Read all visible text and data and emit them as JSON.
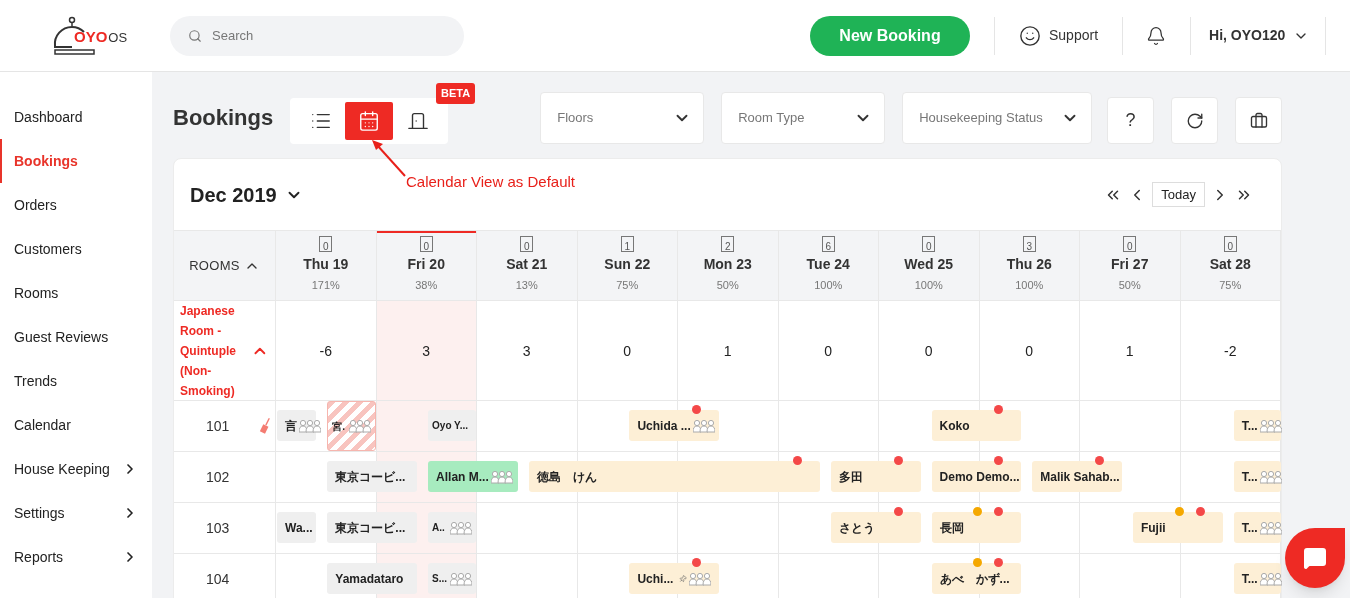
{
  "header": {
    "logo": {
      "brand": "OYO",
      "suffix": "OS"
    },
    "search": {
      "placeholder": "Search"
    },
    "new_booking": "New Booking",
    "support": "Support",
    "user": "Hi, OYO120"
  },
  "sidebar": {
    "items": [
      {
        "label": "Dashboard",
        "selected": false,
        "has_submenu": false
      },
      {
        "label": "Bookings",
        "selected": true,
        "has_submenu": false
      },
      {
        "label": "Orders",
        "selected": false,
        "has_submenu": false
      },
      {
        "label": "Customers",
        "selected": false,
        "has_submenu": false
      },
      {
        "label": "Rooms",
        "selected": false,
        "has_submenu": false
      },
      {
        "label": "Guest Reviews",
        "selected": false,
        "has_submenu": false
      },
      {
        "label": "Trends",
        "selected": false,
        "has_submenu": false
      },
      {
        "label": "Calendar",
        "selected": false,
        "has_submenu": false
      },
      {
        "label": "House Keeping",
        "selected": false,
        "has_submenu": true
      },
      {
        "label": "Settings",
        "selected": false,
        "has_submenu": true
      },
      {
        "label": "Reports",
        "selected": false,
        "has_submenu": true
      }
    ]
  },
  "toolbar": {
    "title": "Bookings",
    "badge": "BETA",
    "views": [
      {
        "kind": "list",
        "selected": false
      },
      {
        "kind": "calendar",
        "selected": true
      },
      {
        "kind": "door",
        "selected": false
      }
    ],
    "filters": [
      {
        "placeholder": "Floors"
      },
      {
        "placeholder": "Room Type"
      },
      {
        "placeholder": "Housekeeping Status"
      }
    ],
    "help": "?"
  },
  "annotation": {
    "text": "Calendar View as Default"
  },
  "calendar": {
    "month": "Dec 2019",
    "today": "Today",
    "rooms_heading": "ROOMS",
    "days": [
      {
        "label": "Thu 19",
        "count": "0",
        "occupancy": "171%",
        "selected": false
      },
      {
        "label": "Fri 20",
        "count": "0",
        "occupancy": "38%",
        "selected": true
      },
      {
        "label": "Sat 21",
        "count": "0",
        "occupancy": "13%",
        "selected": false
      },
      {
        "label": "Sun 22",
        "count": "1",
        "occupancy": "75%",
        "selected": false
      },
      {
        "label": "Mon 23",
        "count": "2",
        "occupancy": "50%",
        "selected": false
      },
      {
        "label": "Tue 24",
        "count": "6",
        "occupancy": "100%",
        "selected": false
      },
      {
        "label": "Wed 25",
        "count": "0",
        "occupancy": "100%",
        "selected": false
      },
      {
        "label": "Thu 26",
        "count": "3",
        "occupancy": "100%",
        "selected": false
      },
      {
        "label": "Fri 27",
        "count": "0",
        "occupancy": "50%",
        "selected": false
      },
      {
        "label": "Sat 28",
        "count": "0",
        "occupancy": "75%",
        "selected": false
      }
    ],
    "category": {
      "name": "Japanese Room - Quintuple (Non-Smoking)",
      "expanded": true,
      "availability": [
        "-6",
        "3",
        "3",
        "0",
        "1",
        "0",
        "0",
        "0",
        "1",
        "-2"
      ]
    },
    "rooms": [
      {
        "number": "101",
        "dirty": true,
        "carried_over": [
          {
            "name": "言",
            "kind": "past",
            "group": true,
            "pinned": false
          }
        ],
        "cells": [
          {
            "bookings": [
              {
                "name": "宮.",
                "kind": "blocked",
                "group": true,
                "pinned": false
              }
            ]
          },
          {
            "bookings": [
              {
                "name": "Oyo Y...",
                "kind": "pastpartial",
                "group": false,
                "pinned": false
              }
            ]
          },
          {},
          {
            "bookings": [
              {
                "name": "Uchida ...",
                "kind": "upcoming",
                "group": true,
                "pinned": false,
                "dots": [
                  {
                    "color": "#f44848"
                  }
                ]
              }
            ]
          },
          {},
          {},
          {
            "bookings": [
              {
                "name": "Koko",
                "kind": "upcoming",
                "group": false,
                "pinned": false,
                "dots": [
                  {
                    "color": "#f44848"
                  }
                ]
              }
            ]
          },
          {},
          {},
          {
            "bookings": [
              {
                "name": "T...",
                "kind": "upcoming",
                "group": true,
                "pinned": false
              }
            ]
          }
        ]
      },
      {
        "number": "102",
        "dirty": false,
        "cells": [
          {
            "bookings": [
              {
                "name": "東京コービ...",
                "kind": "past",
                "group": false,
                "pinned": false
              }
            ]
          },
          {
            "bookings": [
              {
                "name": "Allan M...",
                "kind": "inhouse",
                "group": true,
                "pinned": false
              }
            ]
          },
          {
            "bookings": [
              {
                "name": "徳島　けん",
                "kind": "upcomingtriple",
                "group": false,
                "pinned": false,
                "dots": [
                  {
                    "color": "#f44848"
                  }
                ]
              }
            ]
          },
          {},
          {},
          {
            "bookings": [
              {
                "name": "多田",
                "kind": "upcoming",
                "group": false,
                "pinned": false,
                "dots": [
                  {
                    "color": "#f44848"
                  }
                ]
              }
            ]
          },
          {
            "bookings": [
              {
                "name": "Demo Demo...",
                "kind": "upcoming",
                "group": false,
                "pinned": false,
                "dots": [
                  {
                    "color": "#f44848"
                  }
                ]
              }
            ]
          },
          {
            "bookings": [
              {
                "name": "Malik Sahab...",
                "kind": "upcoming",
                "group": false,
                "pinned": false,
                "dots": [
                  {
                    "color": "#f44848"
                  }
                ]
              }
            ]
          },
          {},
          {
            "bookings": [
              {
                "name": "T...",
                "kind": "upcoming",
                "group": true,
                "pinned": false
              }
            ]
          }
        ]
      },
      {
        "number": "103",
        "dirty": false,
        "carried_over": [
          {
            "name": "Wa...",
            "kind": "past",
            "group": false,
            "pinned": false
          }
        ],
        "cells": [
          {
            "bookings": [
              {
                "name": "東京コービ...",
                "kind": "past",
                "group": false,
                "pinned": false
              }
            ]
          },
          {
            "bookings": [
              {
                "name": "A..",
                "kind": "pastpartial",
                "group": true,
                "pinned": false
              }
            ]
          },
          {},
          {},
          {},
          {
            "bookings": [
              {
                "name": "さとう",
                "kind": "upcoming",
                "group": false,
                "pinned": false,
                "dots": [
                  {
                    "color": "#f44848"
                  }
                ]
              }
            ]
          },
          {
            "bookings": [
              {
                "name": "長岡",
                "kind": "upcoming",
                "group": false,
                "pinned": false,
                "dots": [
                  {
                    "color": "#f5a800"
                  },
                  {
                    "color": "#f44848"
                  }
                ]
              }
            ]
          },
          {},
          {
            "bookings": [
              {
                "name": "Fujii",
                "kind": "upcoming",
                "group": false,
                "pinned": false,
                "dots": [
                  {
                    "color": "#f5a800"
                  },
                  {
                    "color": "#f44848"
                  }
                ]
              }
            ]
          },
          {
            "bookings": [
              {
                "name": "T...",
                "kind": "upcoming",
                "group": true,
                "pinned": false
              }
            ]
          }
        ]
      },
      {
        "number": "104",
        "dirty": false,
        "cells": [
          {
            "bookings": [
              {
                "name": "Yamadataro",
                "kind": "past",
                "group": false,
                "pinned": false
              }
            ]
          },
          {
            "bookings": [
              {
                "name": "S...",
                "kind": "pastpartial",
                "group": true,
                "pinned": false
              }
            ]
          },
          {},
          {
            "bookings": [
              {
                "name": "Uchi...",
                "kind": "upcoming",
                "group": true,
                "pinned": true,
                "dots": [
                  {
                    "color": "#f44848"
                  }
                ]
              }
            ]
          },
          {},
          {},
          {
            "bookings": [
              {
                "name": "あべ　かず...",
                "kind": "upcoming",
                "group": false,
                "pinned": false,
                "dots": [
                  {
                    "color": "#f5a800"
                  },
                  {
                    "color": "#f44848"
                  }
                ]
              }
            ]
          },
          {},
          {},
          {
            "bookings": [
              {
                "name": "T...",
                "kind": "upcoming",
                "group": true,
                "pinned": false
              }
            ]
          }
        ]
      }
    ]
  }
}
